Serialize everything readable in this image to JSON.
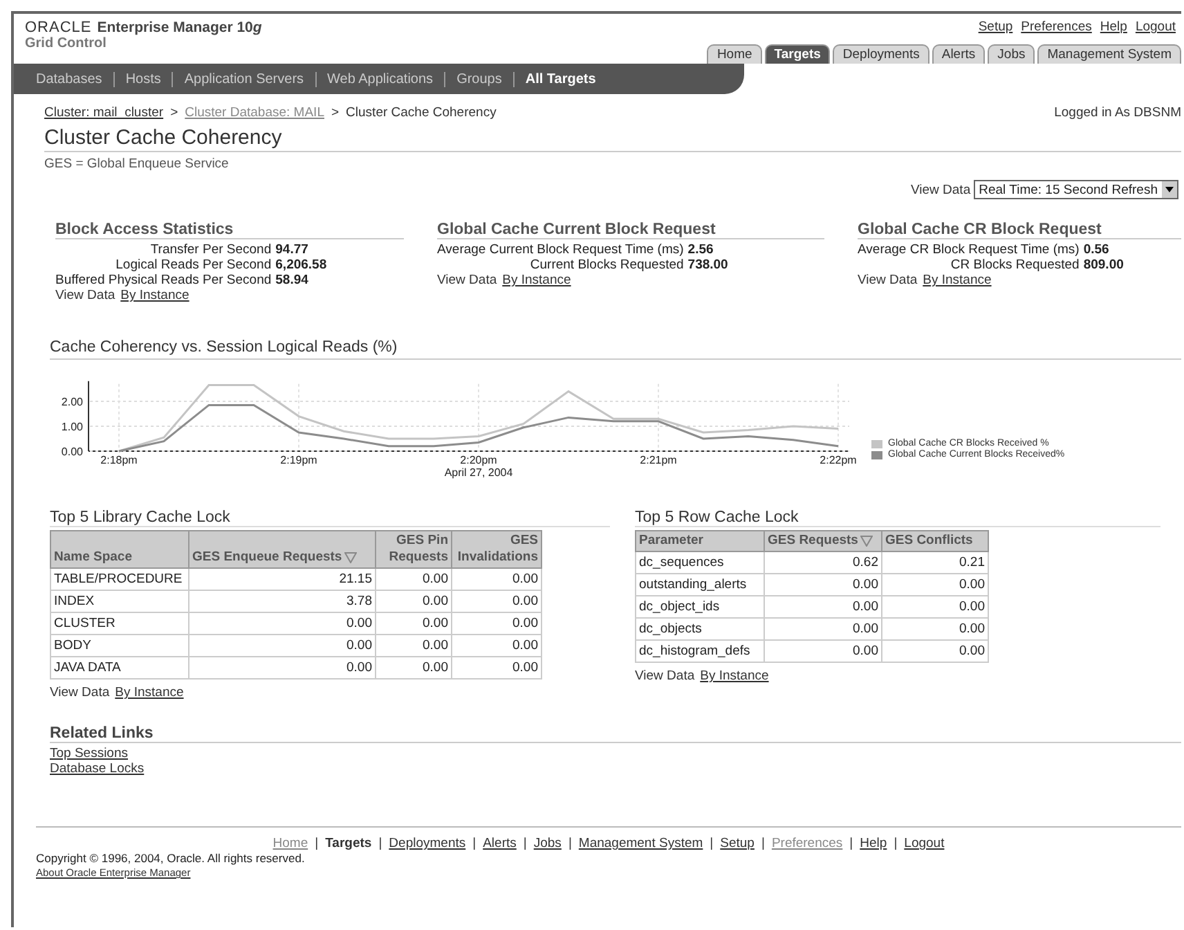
{
  "header": {
    "brand": "ORACLE",
    "product": "Enterprise Manager 10",
    "product_suffix": "g",
    "subtitle": "Grid Control"
  },
  "global_links": [
    "Setup",
    "Preferences",
    "Help",
    "Logout"
  ],
  "tabs": [
    {
      "label": "Home",
      "selected": false
    },
    {
      "label": "Targets",
      "selected": true
    },
    {
      "label": "Deployments",
      "selected": false
    },
    {
      "label": "Alerts",
      "selected": false
    },
    {
      "label": "Jobs",
      "selected": false
    },
    {
      "label": "Management System",
      "selected": false
    }
  ],
  "subtabs": [
    {
      "label": "Databases",
      "selected": false
    },
    {
      "label": "Hosts",
      "selected": false
    },
    {
      "label": "Application Servers",
      "selected": false
    },
    {
      "label": "Web Applications",
      "selected": false
    },
    {
      "label": "Groups",
      "selected": false
    },
    {
      "label": "All Targets",
      "selected": true
    }
  ],
  "breadcrumbs": [
    {
      "label": "Cluster: mail_cluster",
      "kind": "link"
    },
    {
      "label": ">",
      "kind": "separator"
    },
    {
      "label": "Cluster Database: MAIL",
      "kind": "link"
    },
    {
      "label": ">",
      "kind": "separator"
    },
    {
      "label": "Cluster Cache Coherency",
      "kind": "current"
    }
  ],
  "logged_in": "Logged in As DBSNM",
  "page_title": "Cluster Cache Coherency",
  "page_note": "GES = Global Enqueue Service",
  "view_data": {
    "label": "View Data",
    "value": "Real Time: 15 Second Refresh"
  },
  "stat_sections": [
    {
      "title": "Block Access Statistics",
      "rows": [
        {
          "label": "Transfer Per Second",
          "value": "94.77"
        },
        {
          "label": "Logical Reads Per Second",
          "value": "6,206.58"
        },
        {
          "label": "Buffered Physical Reads Per Second",
          "value": "58.94"
        }
      ],
      "view_label": "View Data",
      "view_link": "By Instance"
    },
    {
      "title": "Global Cache Current Block Request",
      "rows": [
        {
          "label": "Average Current Block Request Time (ms)",
          "value": "2.56"
        },
        {
          "label": "Current Blocks Requested",
          "value": "738.00"
        }
      ],
      "view_label": "View Data",
      "view_link": "By Instance"
    },
    {
      "title": "Global Cache CR Block Request",
      "rows": [
        {
          "label": "Average CR Block Request Time (ms)",
          "value": "0.56"
        },
        {
          "label": "CR Blocks Requested",
          "value": "809.00"
        }
      ],
      "view_label": "View Data",
      "view_link": "By Instance"
    }
  ],
  "chart_section": {
    "title": "Cache Coherency vs. Session Logical Reads (%)",
    "chart_data": {
      "type": "line",
      "xlabel": "April 27, 2004",
      "categories": [
        "2:18pm",
        null,
        null,
        null,
        "2:19pm",
        null,
        null,
        null,
        "2:20pm",
        null,
        null,
        null,
        "2:21pm",
        null,
        null,
        null,
        "2:22pm"
      ],
      "series": [
        {
          "name": "Global Cache CR Blocks Received %",
          "color": "#c4c4c4",
          "values": [
            0,
            0.55,
            2.65,
            2.65,
            1.4,
            0.8,
            0.5,
            0.5,
            0.6,
            1.1,
            2.4,
            1.3,
            1.3,
            0.75,
            0.85,
            1.0,
            0.9
          ]
        },
        {
          "name": "Global Cache Current Blocks Received%",
          "color": "#8c8c8c",
          "values": [
            0,
            0.4,
            1.85,
            1.85,
            0.75,
            0.5,
            0.2,
            0.2,
            0.35,
            0.95,
            1.35,
            1.2,
            1.2,
            0.5,
            0.6,
            0.45,
            0.2
          ]
        }
      ],
      "ylim": [
        0,
        2.7
      ],
      "grid": true,
      "yticks": [
        {
          "value": 0,
          "label": "0.00"
        },
        {
          "value": 1,
          "label": "1.00"
        },
        {
          "value": 2,
          "label": "2.00"
        }
      ]
    }
  },
  "tables": [
    {
      "title": "Top 5 Library Cache Lock",
      "columns": [
        {
          "label": "Name Space",
          "sorted": false
        },
        {
          "label": "GES Enqueue Requests",
          "sorted": true
        },
        {
          "label": "GES Pin Requests",
          "sorted": false
        },
        {
          "label": "GES Invalidations",
          "sorted": false
        }
      ],
      "rows": [
        [
          "TABLE/PROCEDURE",
          "21.15",
          "0.00",
          "0.00"
        ],
        [
          "INDEX",
          "3.78",
          "0.00",
          "0.00"
        ],
        [
          "CLUSTER",
          "0.00",
          "0.00",
          "0.00"
        ],
        [
          "BODY",
          "0.00",
          "0.00",
          "0.00"
        ],
        [
          "JAVA DATA",
          "0.00",
          "0.00",
          "0.00"
        ]
      ],
      "view_label": "View Data",
      "view_link": "By Instance"
    },
    {
      "title": "Top 5 Row Cache Lock",
      "columns": [
        {
          "label": "Parameter",
          "sorted": false
        },
        {
          "label": "GES Requests",
          "sorted": true
        },
        {
          "label": "GES Conflicts",
          "sorted": false
        }
      ],
      "rows": [
        [
          "dc_sequences",
          "0.62",
          "0.21"
        ],
        [
          "outstanding_alerts",
          "0.00",
          "0.00"
        ],
        [
          "dc_object_ids",
          "0.00",
          "0.00"
        ],
        [
          "dc_objects",
          "0.00",
          "0.00"
        ],
        [
          "dc_histogram_defs",
          "0.00",
          "0.00"
        ]
      ],
      "view_label": "View Data",
      "view_link": "By Instance"
    }
  ],
  "related_links": {
    "title": "Related Links",
    "links": [
      "Top Sessions",
      "Database Locks"
    ]
  },
  "footer": {
    "links": [
      {
        "label": "Home",
        "kind": "visited"
      },
      {
        "label": "Targets",
        "kind": "current"
      },
      {
        "label": "Deployments",
        "kind": "link"
      },
      {
        "label": "Alerts",
        "kind": "link"
      },
      {
        "label": "Jobs",
        "kind": "link"
      },
      {
        "label": "Management System",
        "kind": "link"
      },
      {
        "label": "Setup",
        "kind": "link"
      },
      {
        "label": "Preferences",
        "kind": "visited"
      },
      {
        "label": "Help",
        "kind": "link"
      },
      {
        "label": "Logout",
        "kind": "link"
      }
    ],
    "separator": "|",
    "copyright": "Copyright © 1996, 2004, Oracle. All rights reserved.",
    "about": "About Oracle Enterprise Manager"
  }
}
